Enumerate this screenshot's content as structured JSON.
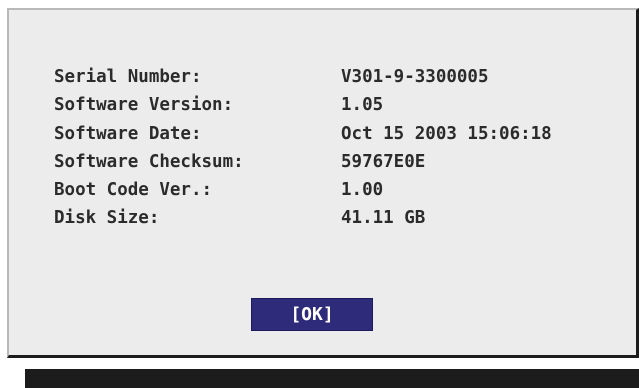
{
  "info": {
    "rows": [
      {
        "label": "Serial Number:",
        "value": "V301-9-3300005"
      },
      {
        "label": "Software Version:",
        "value": "1.05"
      },
      {
        "label": "Software Date:",
        "value": "Oct 15 2003 15:06:18"
      },
      {
        "label": "Software Checksum:",
        "value": "59767E0E"
      },
      {
        "label": "Boot Code Ver.:",
        "value": "1.00"
      },
      {
        "label": "Disk Size:",
        "value": "41.11 GB"
      }
    ]
  },
  "buttons": {
    "ok_label": "[OK]"
  },
  "colors": {
    "dialog_background": "#ececec",
    "button_background": "#2d2b7a",
    "text": "#2b2b2b",
    "border_dark": "#1c1c1c"
  }
}
